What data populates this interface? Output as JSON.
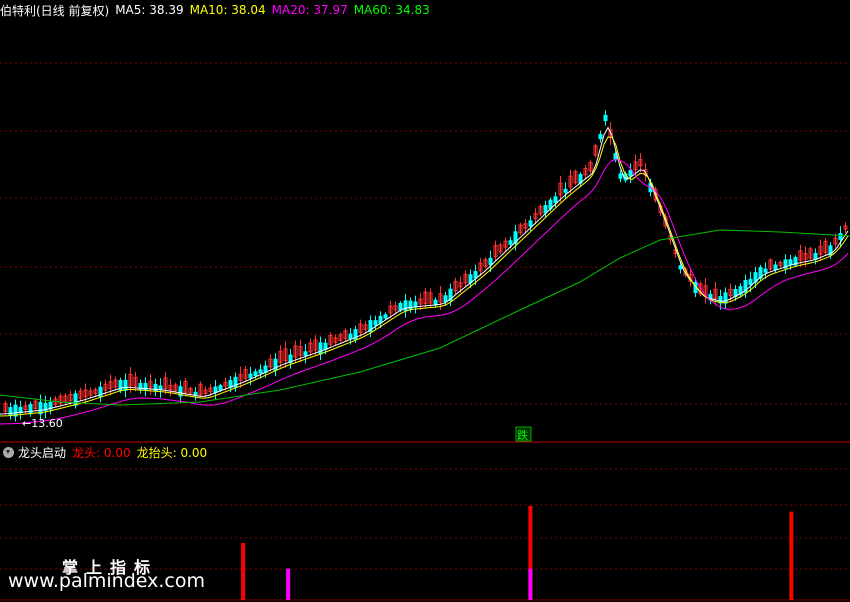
{
  "main_header": {
    "title": "伯特利(日线 前复权)",
    "ma5": {
      "label": "MA5: 38.39",
      "color": "#ffffff"
    },
    "ma10": {
      "label": "MA10: 38.04",
      "color": "#ffff00"
    },
    "ma20": {
      "label": "MA20: 37.97",
      "color": "#ff00ff"
    },
    "ma60": {
      "label": "MA60: 34.83",
      "color": "#00ff00"
    }
  },
  "low_marker": "←13.60",
  "event_tag": "跌",
  "indicator_header": {
    "title": "龙头启动",
    "longtou": {
      "label": "龙头: 0.00",
      "color": "#ff0000"
    },
    "longtaitou": {
      "label": "龙抬头: 0.00",
      "color": "#ffff00"
    }
  },
  "watermark": {
    "line1": "掌上指标",
    "line2": "www.palmindex.com"
  },
  "colors": {
    "up": "#ff3333",
    "down": "#00ffff",
    "grid": "#800000",
    "divider": "#c00000",
    "signal_red": "#ff0000",
    "signal_magenta": "#ff00ff"
  },
  "indicator_bars": [
    {
      "index": 0.286,
      "value": 1,
      "color": "#ff0000"
    },
    {
      "index": 0.339,
      "value": 0.55,
      "color": "#ff00ff"
    },
    {
      "index": 0.624,
      "value": 1.65,
      "color": "#ff0000"
    },
    {
      "index": 0.624,
      "value": 0.55,
      "color": "#ff00ff"
    },
    {
      "index": 0.931,
      "value": 1.55,
      "color": "#ff0000"
    }
  ]
}
